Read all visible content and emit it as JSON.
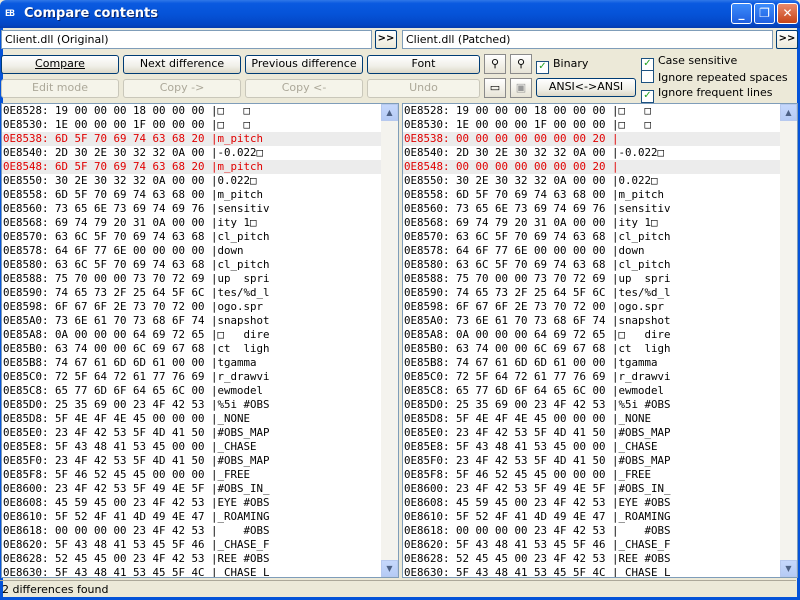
{
  "window": {
    "title": "Compare contents",
    "app_icon": "hex-compare-icon"
  },
  "files": {
    "left_value": "Client.dll (Original)",
    "right_value": "Client.dll (Patched)",
    "browse_label": ">>"
  },
  "toolbar": {
    "compare": "Compare",
    "next_diff": "Next difference",
    "prev_diff": "Previous difference",
    "font": "Font",
    "edit_mode": "Edit mode",
    "copy_right": "Copy ->",
    "copy_left": "Copy <-",
    "undo": "Undo",
    "binary": "Binary",
    "ansi": "ANSI<->ANSI"
  },
  "options": {
    "case_sensitive": "Case sensitive",
    "ignore_repeated_spaces": "Ignore repeated spaces",
    "ignore_frequent_lines": "Ignore frequent lines"
  },
  "left_rows": [
    "0E8528: 19 00 00 00 18 00 00 00 |□   □",
    "0E8530: 1E 00 00 00 1F 00 00 00 |□   □",
    "0E8538: 6D 5F 70 69 74 63 68 20 |m_pitch",
    "0E8540: 2D 30 2E 30 32 32 0A 00 |-0.022□",
    "0E8548: 6D 5F 70 69 74 63 68 20 |m_pitch",
    "0E8550: 30 2E 30 32 32 0A 00 00 |0.022□",
    "0E8558: 6D 5F 70 69 74 63 68 00 |m_pitch",
    "0E8560: 73 65 6E 73 69 74 69 76 |sensitiv",
    "0E8568: 69 74 79 20 31 0A 00 00 |ity 1□",
    "0E8570: 63 6C 5F 70 69 74 63 68 |cl_pitch",
    "0E8578: 64 6F 77 6E 00 00 00 00 |down",
    "0E8580: 63 6C 5F 70 69 74 63 68 |cl_pitch",
    "0E8588: 75 70 00 00 73 70 72 69 |up  spri",
    "0E8590: 74 65 73 2F 25 64 5F 6C |tes/%d_l",
    "0E8598: 6F 67 6F 2E 73 70 72 00 |ogo.spr",
    "0E85A0: 73 6E 61 70 73 68 6F 74 |snapshot",
    "0E85A8: 0A 00 00 00 64 69 72 65 |□   dire",
    "0E85B0: 63 74 00 00 6C 69 67 68 |ct  ligh",
    "0E85B8: 74 67 61 6D 6D 61 00 00 |tgamma",
    "0E85C0: 72 5F 64 72 61 77 76 69 |r_drawvi",
    "0E85C8: 65 77 6D 6F 64 65 6C 00 |ewmodel",
    "0E85D0: 25 35 69 00 23 4F 42 53 |%5i #OBS",
    "0E85D8: 5F 4E 4F 4E 45 00 00 00 |_NONE",
    "0E85E0: 23 4F 42 53 5F 4D 41 50 |#OBS_MAP",
    "0E85E8: 5F 43 48 41 53 45 00 00 |_CHASE",
    "0E85F0: 23 4F 42 53 5F 4D 41 50 |#OBS_MAP",
    "0E85F8: 5F 46 52 45 45 00 00 00 |_FREE",
    "0E8600: 23 4F 42 53 5F 49 4E 5F |#OBS_IN_",
    "0E8608: 45 59 45 00 23 4F 42 53 |EYE #OBS",
    "0E8610: 5F 52 4F 41 4D 49 4E 47 |_ROAMING",
    "0E8618: 00 00 00 00 23 4F 42 53 |    #OBS",
    "0E8620: 5F 43 48 41 53 45 5F 46 |_CHASE_F",
    "0E8628: 52 45 45 00 23 4F 42 53 |REE #OBS",
    "0E8630: 5F 43 48 41 53 45 5F 4C |_CHASE_L"
  ],
  "right_rows": [
    "0E8528: 19 00 00 00 18 00 00 00 |□   □",
    "0E8530: 1E 00 00 00 1F 00 00 00 |□   □",
    "0E8538: 00 00 00 00 00 00 00 20 |",
    "0E8540: 2D 30 2E 30 32 32 0A 00 |-0.022□",
    "0E8548: 00 00 00 00 00 00 00 20 |",
    "0E8550: 30 2E 30 32 32 0A 00 00 |0.022□",
    "0E8558: 6D 5F 70 69 74 63 68 00 |m_pitch",
    "0E8560: 73 65 6E 73 69 74 69 76 |sensitiv",
    "0E8568: 69 74 79 20 31 0A 00 00 |ity 1□",
    "0E8570: 63 6C 5F 70 69 74 63 68 |cl_pitch",
    "0E8578: 64 6F 77 6E 00 00 00 00 |down",
    "0E8580: 63 6C 5F 70 69 74 63 68 |cl_pitch",
    "0E8588: 75 70 00 00 73 70 72 69 |up  spri",
    "0E8590: 74 65 73 2F 25 64 5F 6C |tes/%d_l",
    "0E8598: 6F 67 6F 2E 73 70 72 00 |ogo.spr",
    "0E85A0: 73 6E 61 70 73 68 6F 74 |snapshot",
    "0E85A8: 0A 00 00 00 64 69 72 65 |□   dire",
    "0E85B0: 63 74 00 00 6C 69 67 68 |ct  ligh",
    "0E85B8: 74 67 61 6D 6D 61 00 00 |tgamma",
    "0E85C0: 72 5F 64 72 61 77 76 69 |r_drawvi",
    "0E85C8: 65 77 6D 6F 64 65 6C 00 |ewmodel",
    "0E85D0: 25 35 69 00 23 4F 42 53 |%5i #OBS",
    "0E85D8: 5F 4E 4F 4E 45 00 00 00 |_NONE",
    "0E85E0: 23 4F 42 53 5F 4D 41 50 |#OBS_MAP",
    "0E85E8: 5F 43 48 41 53 45 00 00 |_CHASE",
    "0E85F0: 23 4F 42 53 5F 4D 41 50 |#OBS_MAP",
    "0E85F8: 5F 46 52 45 45 00 00 00 |_FREE",
    "0E8600: 23 4F 42 53 5F 49 4E 5F |#OBS_IN_",
    "0E8608: 45 59 45 00 23 4F 42 53 |EYE #OBS",
    "0E8610: 5F 52 4F 41 4D 49 4E 47 |_ROAMING",
    "0E8618: 00 00 00 00 23 4F 42 53 |    #OBS",
    "0E8620: 5F 43 48 41 53 45 5F 46 |_CHASE_F",
    "0E8628: 52 45 45 00 23 4F 42 53 |REE #OBS",
    "0E8630: 5F 43 48 41 53 45 5F 4C |_CHASE_L"
  ],
  "diff_rows": [
    2,
    4
  ],
  "status": "2 differences found",
  "colors": {
    "diff_text": "#e00000",
    "title_blue": "#0553d8"
  }
}
